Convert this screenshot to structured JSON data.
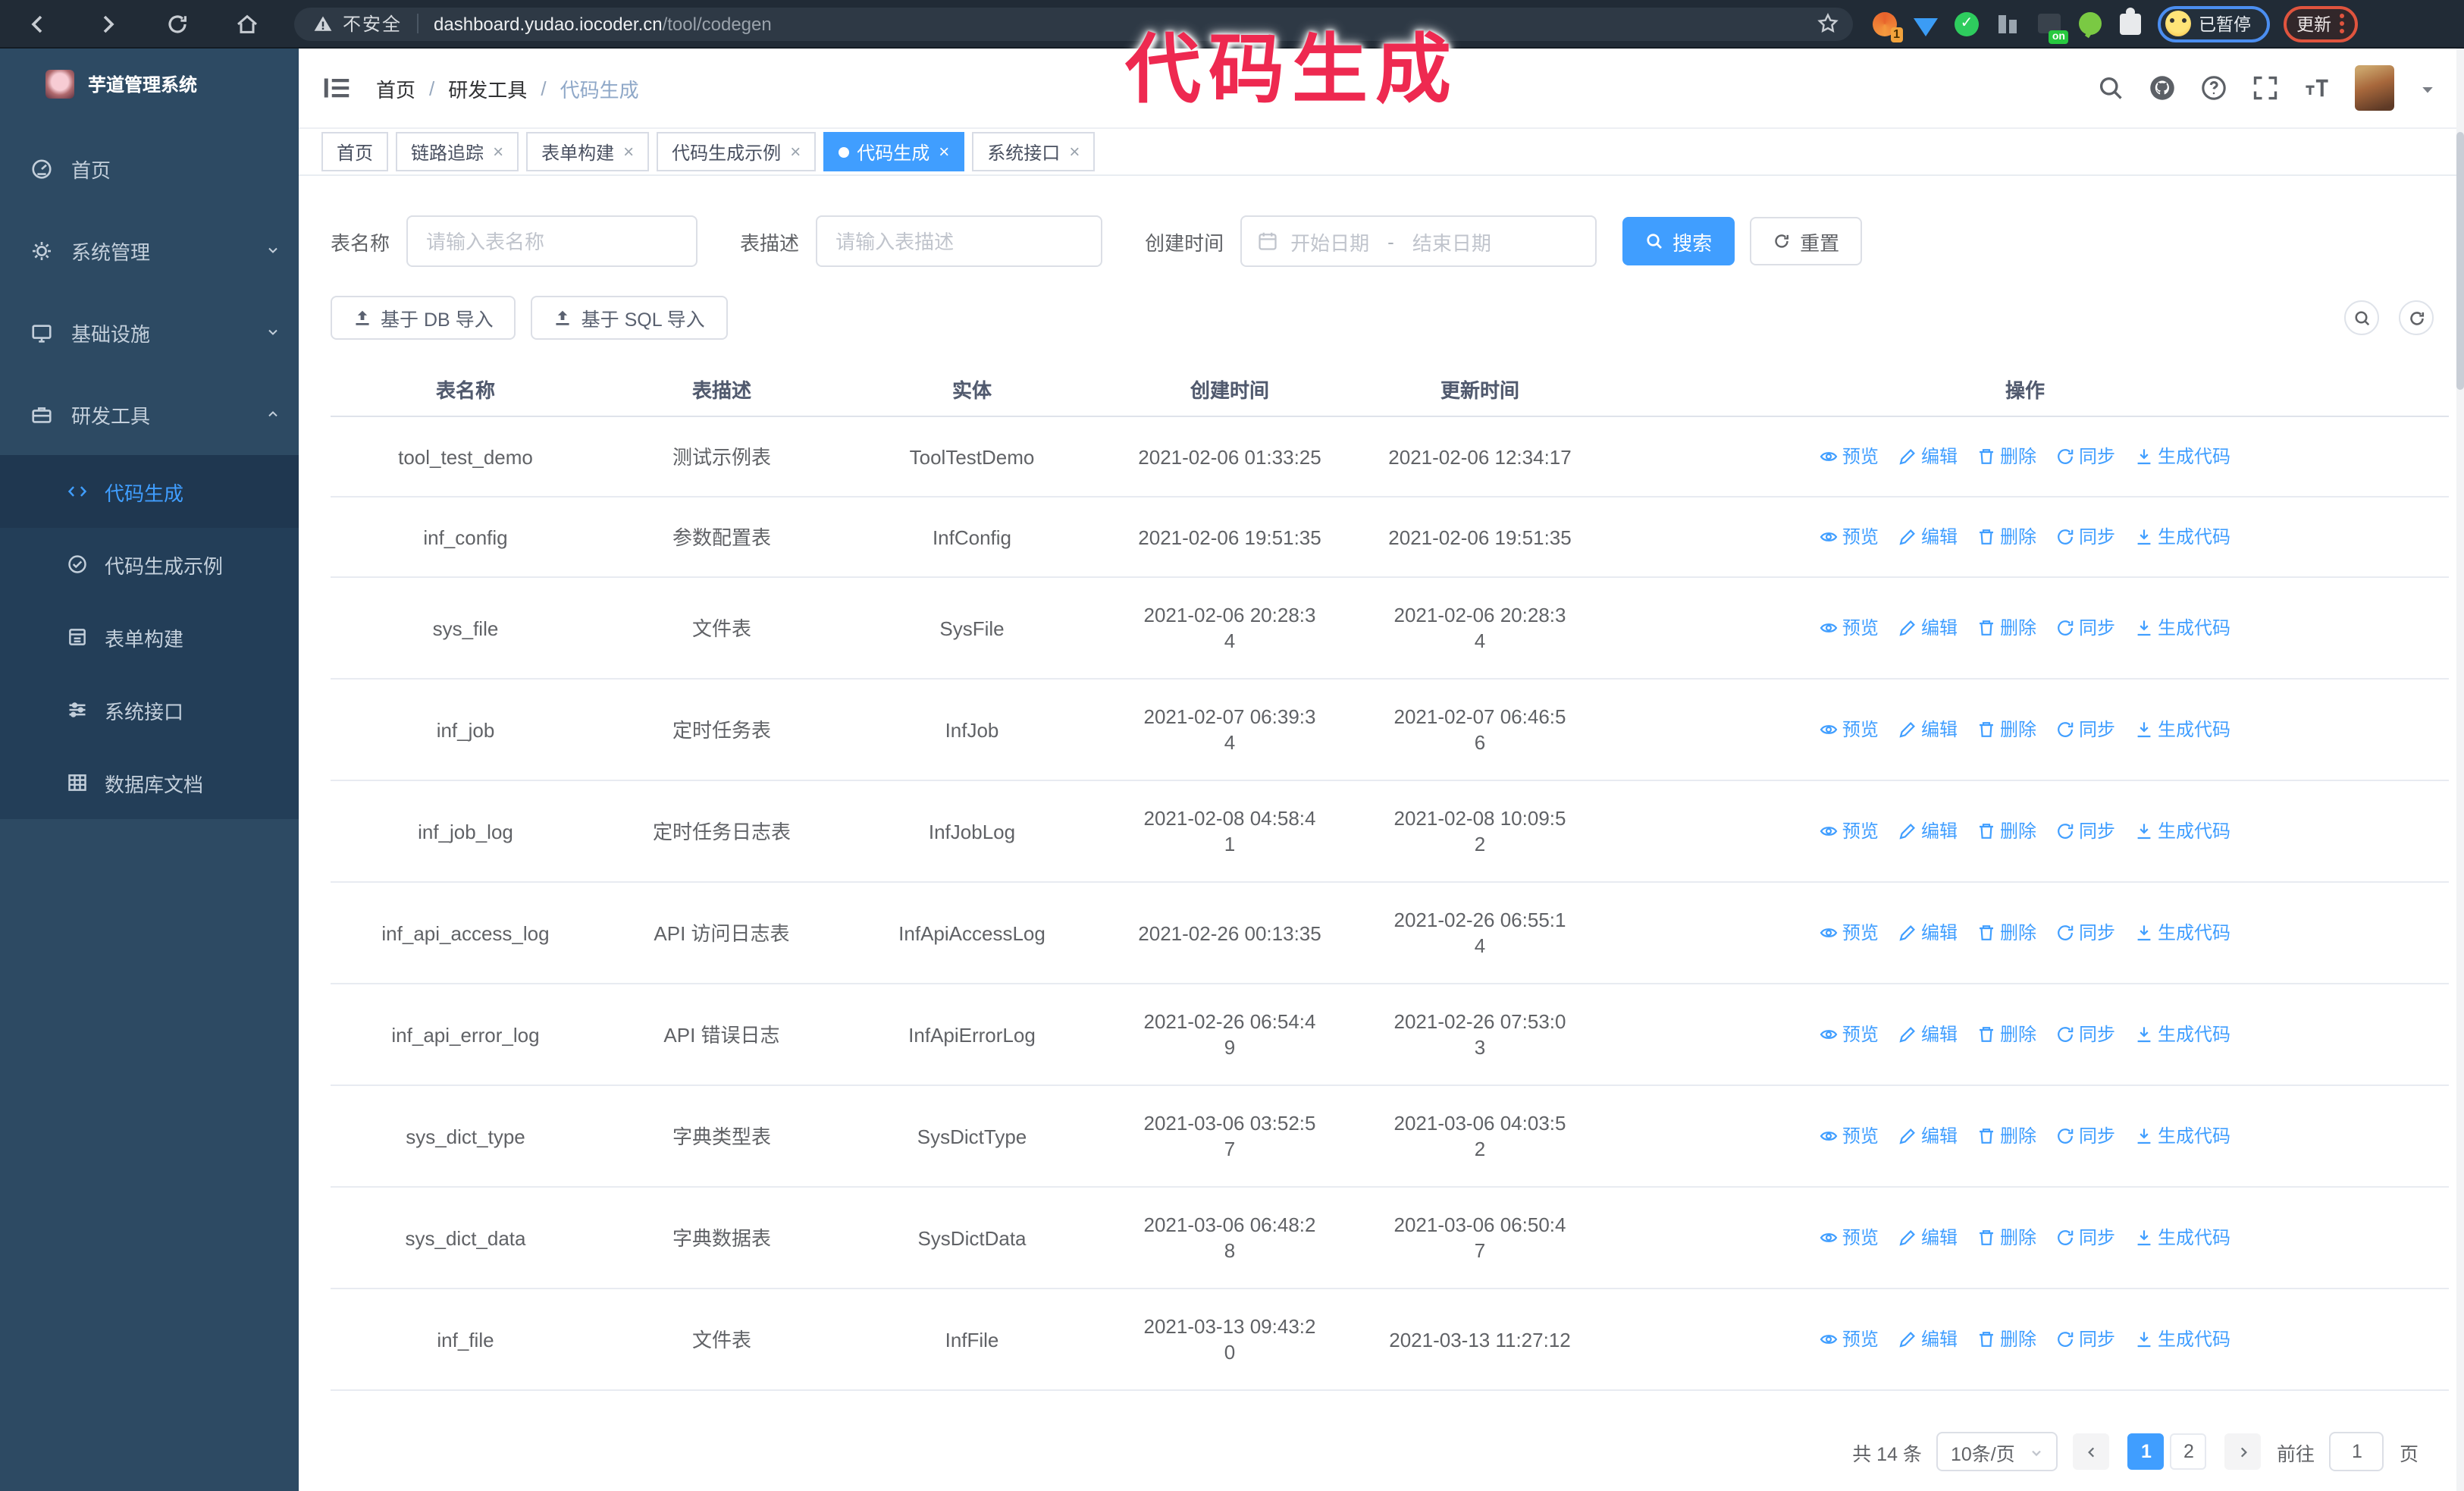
{
  "browser": {
    "security_label": "不安全",
    "url_domain": "dashboard.yudao.iocoder.cn",
    "url_path": "/tool/codegen",
    "extensions": {
      "badge_1": "1",
      "badge_on": "on",
      "paused_label": "已暂停",
      "update_label": "更新"
    }
  },
  "overlay": {
    "watermark": "代码生成",
    "watermark_color": "#ee2950"
  },
  "app": {
    "logo_title": "芋道管理系统",
    "accent_color": "#409eff",
    "sidebar": {
      "items": [
        {
          "label": "首页",
          "expandable": false,
          "open": false
        },
        {
          "label": "系统管理",
          "expandable": true,
          "open": false
        },
        {
          "label": "基础设施",
          "expandable": true,
          "open": false
        },
        {
          "label": "研发工具",
          "expandable": true,
          "open": true
        }
      ],
      "submenu": [
        {
          "label": "代码生成",
          "active": true
        },
        {
          "label": "代码生成示例",
          "active": false
        },
        {
          "label": "表单构建",
          "active": false
        },
        {
          "label": "系统接口",
          "active": false
        },
        {
          "label": "数据库文档",
          "active": false
        }
      ]
    },
    "breadcrumb": [
      "首页",
      "研发工具",
      "代码生成"
    ],
    "tabs": [
      {
        "label": "首页",
        "closable": false,
        "active": false
      },
      {
        "label": "链路追踪",
        "closable": true,
        "active": false
      },
      {
        "label": "表单构建",
        "closable": true,
        "active": false
      },
      {
        "label": "代码生成示例",
        "closable": true,
        "active": false
      },
      {
        "label": "代码生成",
        "closable": true,
        "active": true
      },
      {
        "label": "系统接口",
        "closable": true,
        "active": false
      }
    ],
    "filters": {
      "name_label": "表名称",
      "name_placeholder": "请输入表名称",
      "desc_label": "表描述",
      "desc_placeholder": "请输入表描述",
      "time_label": "创建时间",
      "start_placeholder": "开始日期",
      "range_separator": "-",
      "end_placeholder": "结束日期",
      "search_label": "搜索",
      "reset_label": "重置"
    },
    "toolbar": {
      "import_db_label": "基于 DB 导入",
      "import_sql_label": "基于 SQL 导入"
    },
    "table": {
      "columns": [
        "表名称",
        "表描述",
        "实体",
        "创建时间",
        "更新时间",
        "操作"
      ],
      "action_labels": [
        "预览",
        "编辑",
        "删除",
        "同步",
        "生成代码"
      ],
      "rows": [
        {
          "name": "tool_test_demo",
          "desc": "测试示例表",
          "entity": "ToolTestDemo",
          "created": "2021-02-06 01:33:25",
          "updated": "2021-02-06 12:34:17",
          "created_wrap": false,
          "updated_wrap": false
        },
        {
          "name": "inf_config",
          "desc": "参数配置表",
          "entity": "InfConfig",
          "created": "2021-02-06 19:51:35",
          "updated": "2021-02-06 19:51:35",
          "created_wrap": false,
          "updated_wrap": false
        },
        {
          "name": "sys_file",
          "desc": "文件表",
          "entity": "SysFile",
          "created": "2021-02-06 20:28:34",
          "updated": "2021-02-06 20:28:34",
          "created_wrap": true,
          "updated_wrap": true
        },
        {
          "name": "inf_job",
          "desc": "定时任务表",
          "entity": "InfJob",
          "created": "2021-02-07 06:39:34",
          "updated": "2021-02-07 06:46:56",
          "created_wrap": true,
          "updated_wrap": true
        },
        {
          "name": "inf_job_log",
          "desc": "定时任务日志表",
          "entity": "InfJobLog",
          "created": "2021-02-08 04:58:41",
          "updated": "2021-02-08 10:09:52",
          "created_wrap": true,
          "updated_wrap": true
        },
        {
          "name": "inf_api_access_log",
          "desc": "API 访问日志表",
          "entity": "InfApiAccessLog",
          "created": "2021-02-26 00:13:35",
          "updated": "2021-02-26 06:55:14",
          "created_wrap": false,
          "updated_wrap": true
        },
        {
          "name": "inf_api_error_log",
          "desc": "API 错误日志",
          "entity": "InfApiErrorLog",
          "created": "2021-02-26 06:54:49",
          "updated": "2021-02-26 07:53:03",
          "created_wrap": true,
          "updated_wrap": true
        },
        {
          "name": "sys_dict_type",
          "desc": "字典类型表",
          "entity": "SysDictType",
          "created": "2021-03-06 03:52:57",
          "updated": "2021-03-06 04:03:52",
          "created_wrap": true,
          "updated_wrap": true
        },
        {
          "name": "sys_dict_data",
          "desc": "字典数据表",
          "entity": "SysDictData",
          "created": "2021-03-06 06:48:28",
          "updated": "2021-03-06 06:50:47",
          "created_wrap": true,
          "updated_wrap": true
        },
        {
          "name": "inf_file",
          "desc": "文件表",
          "entity": "InfFile",
          "created": "2021-03-13 09:43:20",
          "updated": "2021-03-13 11:27:12",
          "created_wrap": true,
          "updated_wrap": false
        }
      ]
    },
    "pagination": {
      "total_label": "共 14 条",
      "page_size_label": "10条/页",
      "pages": [
        "1",
        "2"
      ],
      "active_page": "1",
      "goto_label": "前往",
      "goto_value": "1",
      "goto_unit": "页"
    }
  }
}
